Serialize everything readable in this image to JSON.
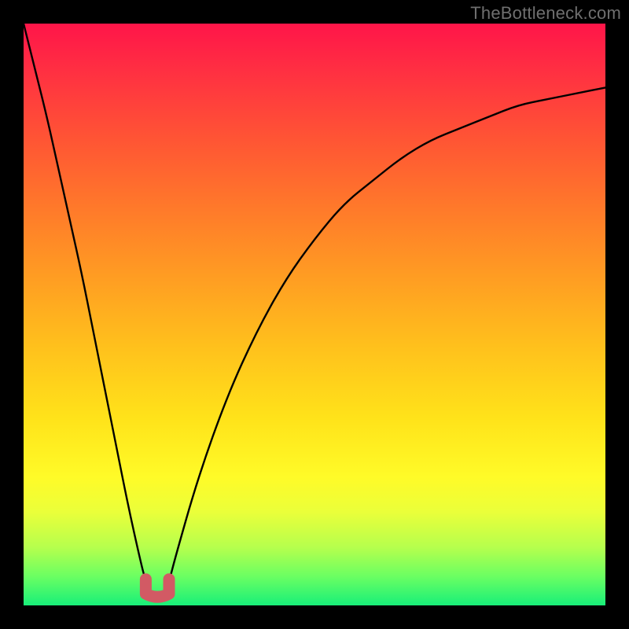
{
  "watermark": "TheBottleneck.com",
  "colors": {
    "page_bg": "#000000",
    "gradient_top": "#ff1549",
    "gradient_mid": "#ffe31a",
    "gradient_bottom": "#18ef79",
    "curve": "#000000",
    "marker": "#d25a64",
    "watermark": "#6f6f6f"
  },
  "chart_data": {
    "type": "line",
    "title": "",
    "xlabel": "",
    "ylabel": "",
    "xlim": [
      0,
      100
    ],
    "ylim": [
      0,
      100
    ],
    "grid": false,
    "legend": false,
    "annotations": [],
    "series": [
      {
        "name": "bottleneck-curve",
        "comment": "Implied V-shaped bottleneck severity curve over a normalized x-axis. Values estimated from pixel positions; 100 = top (worst / red), 0 = bottom (best / green).",
        "x": [
          0,
          2,
          4,
          6,
          8,
          10,
          12,
          14,
          16,
          18,
          20,
          21,
          22,
          23,
          24,
          25,
          26,
          30,
          35,
          40,
          45,
          50,
          55,
          60,
          65,
          70,
          75,
          80,
          85,
          90,
          95,
          100
        ],
        "values": [
          100,
          92,
          84,
          75,
          66,
          57,
          47,
          37,
          27,
          17,
          8,
          4,
          2,
          2,
          2,
          4,
          8,
          22,
          36,
          47,
          56,
          63,
          69,
          73,
          77,
          80,
          82,
          84,
          86,
          87,
          88,
          89
        ]
      }
    ],
    "min_marker": {
      "comment": "Pink U-shaped marker at the curve minimum (approx. x 21–25, y ≈ 2–4%).",
      "x_range": [
        21,
        25
      ],
      "y": 2
    },
    "background_gradient": {
      "comment": "Vertical heat gradient mapping y=100→red through yellow to y=0→green, independent of x.",
      "stops": [
        {
          "y": 100,
          "color": "#ff1549"
        },
        {
          "y": 70,
          "color": "#ff9e22"
        },
        {
          "y": 40,
          "color": "#ffe31a"
        },
        {
          "y": 10,
          "color": "#b6ff4d"
        },
        {
          "y": 0,
          "color": "#18ef79"
        }
      ]
    }
  }
}
